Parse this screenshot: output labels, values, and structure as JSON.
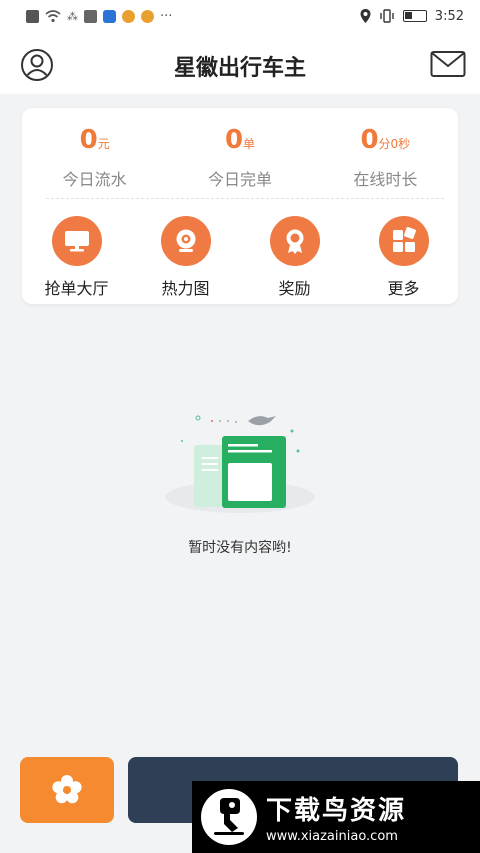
{
  "status_bar": {
    "time": "3:52",
    "dots": "···"
  },
  "header": {
    "title": "星徽出行车主"
  },
  "stats": [
    {
      "value": "0",
      "unit": "元",
      "label": "今日流水"
    },
    {
      "value": "0",
      "unit": "单",
      "label": "今日完单"
    },
    {
      "value": "0",
      "unit": "分0秒",
      "label": "在线时长"
    }
  ],
  "actions": [
    {
      "label": "抢单大厅",
      "icon": "monitor-icon"
    },
    {
      "label": "热力图",
      "icon": "camera-icon"
    },
    {
      "label": "奖励",
      "icon": "medal-icon"
    },
    {
      "label": "更多",
      "icon": "grid-icon"
    }
  ],
  "empty_state": {
    "message": "暂时没有内容哟!"
  },
  "bottom": {
    "online_label": ""
  },
  "watermark": {
    "title": "下载鸟资源",
    "url": "www.xiazainiao.com"
  },
  "colors": {
    "accent": "#f07a3a",
    "button_orange": "#f58a30",
    "button_dark": "#2f3f55"
  }
}
